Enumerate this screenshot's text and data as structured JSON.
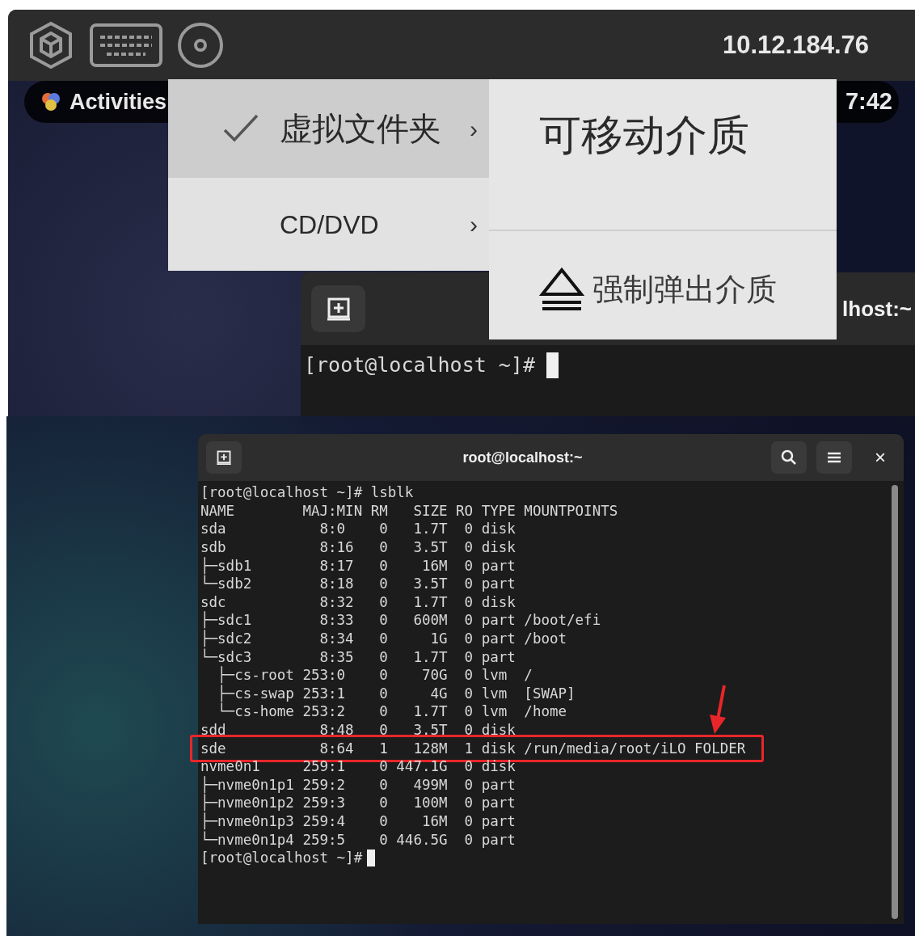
{
  "top_screenshot": {
    "toolbar": {
      "address": "10.12.184.76"
    },
    "top_bar": {
      "activities": "Activities",
      "clock": "7:42"
    },
    "menu": {
      "items": [
        {
          "label": "虚拟文件夹",
          "checked": true,
          "selected": true,
          "submenu_arrow": "›"
        },
        {
          "label": "CD/DVD",
          "checked": false,
          "selected": false,
          "submenu_arrow": "›"
        }
      ]
    },
    "submenu": {
      "items": [
        {
          "kind": "heading",
          "label": "可移动介质"
        },
        {
          "kind": "action",
          "label": "强制弹出介质"
        }
      ]
    },
    "terminal": {
      "title": "lhost:~",
      "prompt": "[root@localhost ~]#",
      "cursor": true
    }
  },
  "bottom_screenshot": {
    "terminal": {
      "title": "root@localhost:~",
      "close": "×",
      "lines": [
        {
          "text": "[root@localhost ~]# lsblk",
          "highlighted": false
        },
        {
          "text": "NAME        MAJ:MIN RM   SIZE RO TYPE MOUNTPOINTS",
          "highlighted": false
        },
        {
          "text": "sda           8:0    0   1.7T  0 disk",
          "highlighted": false
        },
        {
          "text": "sdb           8:16   0   3.5T  0 disk",
          "highlighted": false
        },
        {
          "text": "├─sdb1        8:17   0    16M  0 part",
          "highlighted": false
        },
        {
          "text": "└─sdb2        8:18   0   3.5T  0 part",
          "highlighted": false
        },
        {
          "text": "sdc           8:32   0   1.7T  0 disk",
          "highlighted": false
        },
        {
          "text": "├─sdc1        8:33   0   600M  0 part /boot/efi",
          "highlighted": false
        },
        {
          "text": "├─sdc2        8:34   0     1G  0 part /boot",
          "highlighted": false
        },
        {
          "text": "└─sdc3        8:35   0   1.7T  0 part",
          "highlighted": false
        },
        {
          "text": "  ├─cs-root 253:0    0    70G  0 lvm  /",
          "highlighted": false
        },
        {
          "text": "  ├─cs-swap 253:1    0     4G  0 lvm  [SWAP]",
          "highlighted": false
        },
        {
          "text": "  └─cs-home 253:2    0   1.7T  0 lvm  /home",
          "highlighted": false
        },
        {
          "text": "sdd           8:48   0   3.5T  0 disk",
          "highlighted": false
        },
        {
          "text": "sde           8:64   1   128M  1 disk /run/media/root/iLO FOLDER",
          "highlighted": true
        },
        {
          "text": "nvme0n1     259:1    0 447.1G  0 disk",
          "highlighted": false
        },
        {
          "text": "├─nvme0n1p1 259:2    0   499M  0 part",
          "highlighted": false
        },
        {
          "text": "├─nvme0n1p2 259:3    0   100M  0 part",
          "highlighted": false
        },
        {
          "text": "├─nvme0n1p3 259:4    0    16M  0 part",
          "highlighted": false
        },
        {
          "text": "└─nvme0n1p4 259:5    0 446.5G  0 part",
          "highlighted": false
        }
      ],
      "prompt": "[root@localhost ~]#",
      "cursor": true
    }
  }
}
